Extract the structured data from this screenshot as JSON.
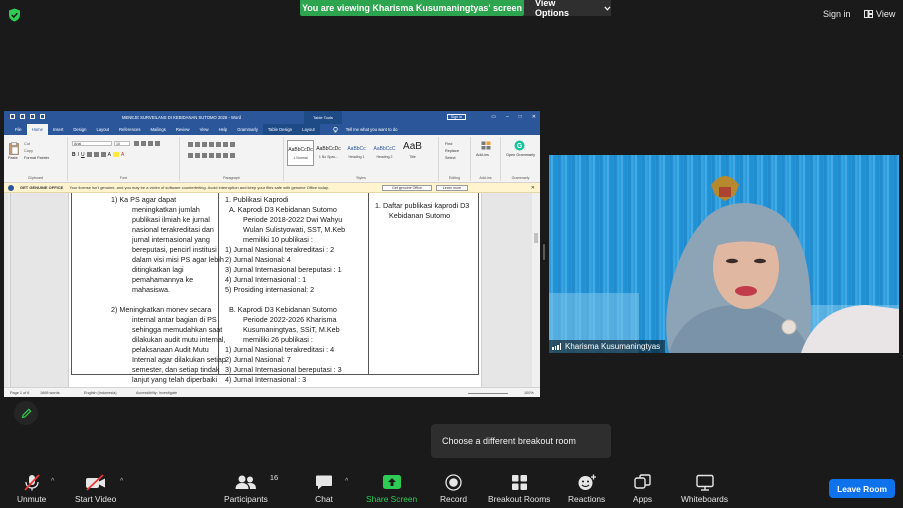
{
  "topbar": {
    "share_banner": "You are viewing Kharisma Kusumaningtyas' screen",
    "view_options": "View Options",
    "sign_in": "Sign in",
    "view": "View"
  },
  "word": {
    "doc_title": "MENEJE SURVEILANS DI KEBIDANAN SUTOMO 2026  -  Word",
    "context_tools": "Table Tools",
    "sign_in": "Sign in",
    "tabs": [
      "File",
      "Home",
      "Insert",
      "Design",
      "Layout",
      "References",
      "Mailings",
      "Review",
      "View",
      "Help",
      "Grammarly",
      "Table Design",
      "Layout"
    ],
    "tell_me": "Tell me what you want to do",
    "ribbon": {
      "paste": "Paste",
      "cut": "Cut",
      "copy": "Copy",
      "format_painter": "Format Painter",
      "clipboard": "Clipboard",
      "font_name": "Arial",
      "font_size": "10",
      "font": "Font",
      "paragraph": "Paragraph",
      "styles": [
        {
          "preview": "AaBbCcDc",
          "name": "1 Normal"
        },
        {
          "preview": "AaBbCcDc",
          "name": "1 No Spac..."
        },
        {
          "preview": "AaBbCc",
          "name": "Heading 1"
        },
        {
          "preview": "AaBbCcC",
          "name": "Heading 2"
        },
        {
          "preview": "AaB",
          "name": "Title"
        }
      ],
      "styles_label": "Styles",
      "find": "Find",
      "replace": "Replace",
      "select": "Select",
      "editing": "Editing",
      "addins": "Add-ins",
      "addins_group": "Add-ins",
      "grammarly_btn": "Open Grammarly",
      "grammarly_group": "Grammarly"
    },
    "alert": {
      "title": "GET GENUINE OFFICE",
      "message": "Your license isn't genuine, and you may be a victim of software counterfeiting. Avoid interruption and keep your files safe with genuine Office today.",
      "get_btn": "Get genuine Office",
      "learn_btn": "Learn more"
    },
    "col1": [
      "1)  Ka PS agar dapat",
      "meningkatkan jumlah",
      "publikasi ilmiah ke jurnal",
      "nasional terakreditasi dan",
      "jurnal internasional yang",
      "bereputasi, pencirl institusi",
      "dalam visi misi PS agar lebih",
      "ditingkatkan lagi",
      "pemahamannya ke",
      "mahasiswa.",
      "",
      "2)  Meningkatkan monev secara",
      "internal antar bagian di PS",
      "sehingga memudahkan saat",
      "dilakukan audit mutu internal,",
      "pelaksanaan Audit Mutu",
      "Internal agar dilakukan setiap",
      "semester, dan setiap tindak",
      "lanjut yang telah diperbaiki"
    ],
    "col2": [
      "1.  Publikasi Kaprodi",
      "A.  Kaprodi D3 Kebidanan Sutomo",
      "Periode 2018-2022 Dwi Wahyu",
      "Wulan Sulistyowati, SST, M.Keb",
      "memiliki 10 publikasi :",
      "1)   Jurnal Nasional terakreditasi : 2",
      "2)   Jurnal Nasional: 4",
      "3)   Jurnal Internasional bereputasi : 1",
      "4)   Jurnal Internasional : 1",
      "5)   Prosiding internasional: 2",
      "",
      "B.  Kaprodi D3 Kebidanan Sutomo",
      "Periode 2022-2026 Kharisma",
      "Kusumaningtyas, SSiT, M.Keb",
      "memiliki 26 publikasi :",
      "1)   Jurnal Nasional terakreditasi : 4",
      "2)   Jurnal Nasional: 7",
      "3)   Jurnal Internasional bereputasi : 3",
      "4)   Jurnal Internasional : 3"
    ],
    "col3": [
      "1.  Daftar publikasi kaprodi D3",
      "Kebidanan Sutomo"
    ],
    "status": {
      "page": "Page 1 of 6",
      "words": "1668 words",
      "language": "English (Indonesia)",
      "accessibility": "Accessibility: Investigate",
      "zoom": "100%"
    }
  },
  "participant": {
    "name": "Kharisma Kusumaningtyas"
  },
  "tooltip": "Choose a different breakout room",
  "toolbar": {
    "unmute": "Unmute",
    "start_video": "Start Video",
    "participants": "Participants",
    "participants_count": "16",
    "chat": "Chat",
    "share_screen": "Share Screen",
    "record": "Record",
    "breakout_rooms": "Breakout Rooms",
    "reactions": "Reactions",
    "apps": "Apps",
    "whiteboards": "Whiteboards",
    "leave": "Leave Room"
  }
}
